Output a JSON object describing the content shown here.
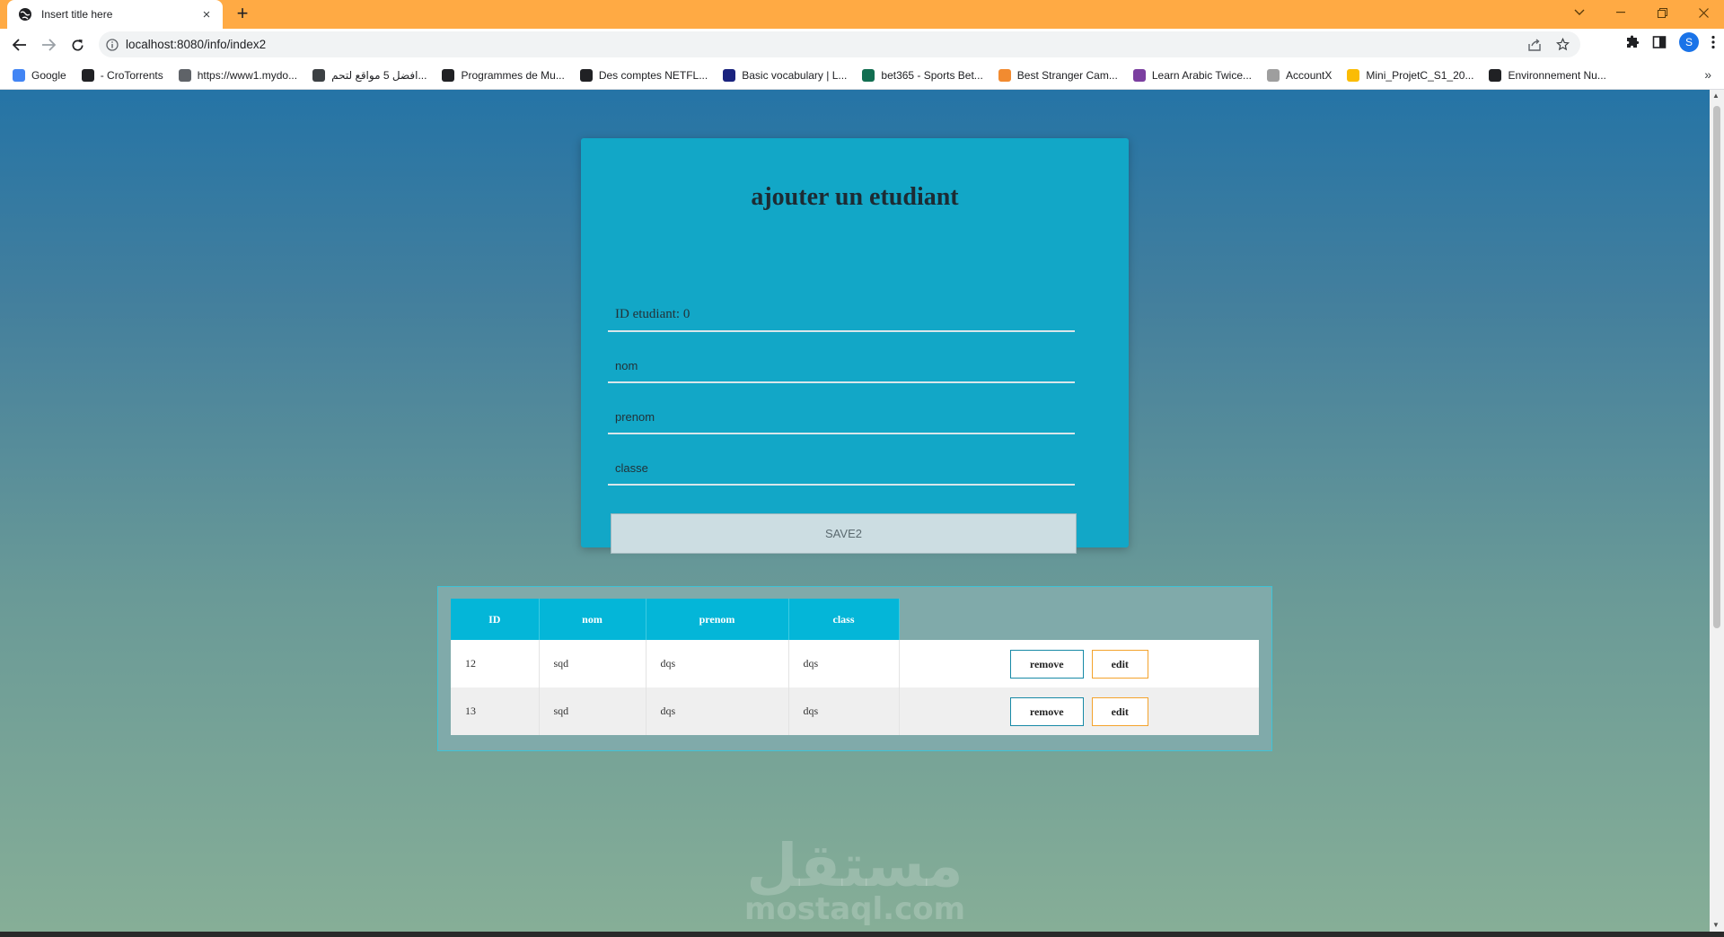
{
  "browser": {
    "tab_title": "Insert title here",
    "tab_close": "×",
    "new_tab": "+",
    "url": "localhost:8080/info/index2",
    "profile_initial": "S",
    "bookmarks_more": "»",
    "bookmarks": [
      {
        "label": "Google",
        "color": "#4285f4"
      },
      {
        "label": "- CroTorrents",
        "color": "#202124"
      },
      {
        "label": "https://www1.mydo...",
        "color": "#5f6368"
      },
      {
        "label": "افضل 5 مواقع لتحم...",
        "color": "#3c4043"
      },
      {
        "label": "Programmes de Mu...",
        "color": "#202124"
      },
      {
        "label": "Des comptes NETFL...",
        "color": "#202124"
      },
      {
        "label": "Basic vocabulary | L...",
        "color": "#1a237e"
      },
      {
        "label": "bet365 - Sports Bet...",
        "color": "#126e51"
      },
      {
        "label": "Best Stranger Cam...",
        "color": "#f28b30"
      },
      {
        "label": "Learn Arabic Twice...",
        "color": "#7b3fa0"
      },
      {
        "label": "AccountX",
        "color": "#9e9e9e"
      },
      {
        "label": "Mini_ProjetC_S1_20...",
        "color": "#fbbc04"
      },
      {
        "label": "Environnement Nu...",
        "color": "#202124"
      }
    ]
  },
  "form": {
    "title": "ajouter un etudiant",
    "id_placeholder": "ID etudiant: 0",
    "nom_placeholder": "nom",
    "prenom_placeholder": "prenom",
    "classe_placeholder": "classe",
    "save_label": "SAVE2"
  },
  "table": {
    "headers": [
      "ID",
      "nom",
      "prenom",
      "class"
    ],
    "rows": [
      {
        "id": "12",
        "nom": "sqd",
        "prenom": "dqs",
        "class": "dqs"
      },
      {
        "id": "13",
        "nom": "sqd",
        "prenom": "dqs",
        "class": "dqs"
      }
    ],
    "remove_label": "remove",
    "edit_label": "edit"
  },
  "watermark": {
    "arabic": "مستقل",
    "latin": "mostaql.com"
  }
}
